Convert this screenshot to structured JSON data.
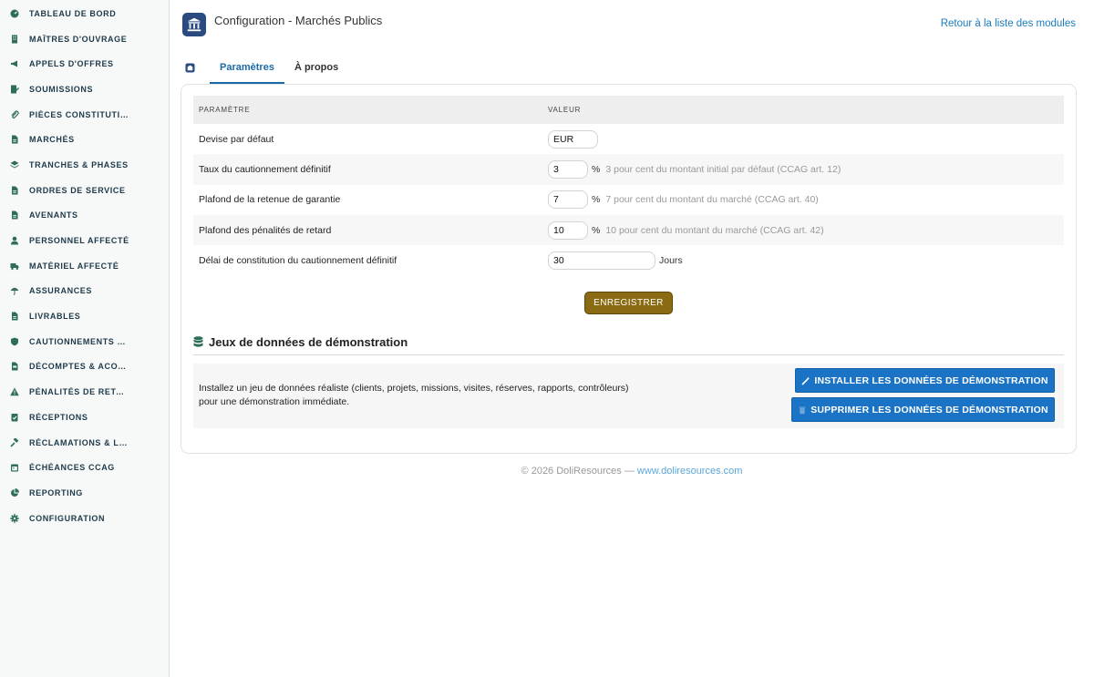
{
  "sidebar": {
    "items": [
      {
        "label": "TABLEAU DE BORD",
        "icon": "dashboard-icon"
      },
      {
        "label": "MAÎTRES D'OUVRAGE",
        "icon": "building-icon"
      },
      {
        "label": "APPELS D'OFFRES",
        "icon": "megaphone-icon"
      },
      {
        "label": "SOUMISSIONS",
        "icon": "file-signature-icon"
      },
      {
        "label": "PIÈCES CONSTITUTIV...",
        "icon": "paperclip-icon"
      },
      {
        "label": "MARCHÉS",
        "icon": "file-icon"
      },
      {
        "label": "TRANCHES & PHASES",
        "icon": "layers-icon"
      },
      {
        "label": "ORDRES DE SERVICE",
        "icon": "file-icon"
      },
      {
        "label": "AVENANTS",
        "icon": "file-icon"
      },
      {
        "label": "PERSONNEL AFFECTÉ",
        "icon": "user-icon"
      },
      {
        "label": "MATÉRIEL AFFECTÉ",
        "icon": "truck-icon"
      },
      {
        "label": "ASSURANCES",
        "icon": "umbrella-icon"
      },
      {
        "label": "LIVRABLES",
        "icon": "file-icon"
      },
      {
        "label": "CAUTIONNEMENTS & ...",
        "icon": "shield-icon"
      },
      {
        "label": "DÉCOMPTES & ACOM...",
        "icon": "file-invoice-icon"
      },
      {
        "label": "PÉNALITÉS DE RETARD",
        "icon": "warning-icon"
      },
      {
        "label": "RÉCEPTIONS",
        "icon": "clipboard-check-icon"
      },
      {
        "label": "RÉCLAMATIONS & LIT...",
        "icon": "gavel-icon"
      },
      {
        "label": "ÉCHÉANCES CCAG",
        "icon": "calendar-icon"
      },
      {
        "label": "REPORTING",
        "icon": "pie-chart-icon"
      },
      {
        "label": "CONFIGURATION",
        "icon": "gear-icon"
      }
    ]
  },
  "header": {
    "title": "Configuration - Marchés Publics",
    "back_link": "Retour à la liste des modules"
  },
  "tabs": [
    {
      "label": "Paramètres",
      "active": true
    },
    {
      "label": "À propos",
      "active": false
    }
  ],
  "table": {
    "col_param": "Paramètre",
    "col_value": "Valeur",
    "rows": [
      {
        "label": "Devise par défaut",
        "value": "EUR",
        "unit": "",
        "hint": ""
      },
      {
        "label": "Taux du cautionnement définitif",
        "value": "3",
        "unit": "%",
        "hint": "3 pour cent du montant initial par défaut (CCAG art. 12)"
      },
      {
        "label": "Plafond de la retenue de garantie",
        "value": "7",
        "unit": "%",
        "hint": "7 pour cent du montant du marché (CCAG art. 40)"
      },
      {
        "label": "Plafond des pénalités de retard",
        "value": "10",
        "unit": "%",
        "hint": "10 pour cent du montant du marché (CCAG art. 42)"
      },
      {
        "label": "Délai de constitution du cautionnement définitif",
        "value": "30",
        "unit": "Jours",
        "hint": ""
      }
    ]
  },
  "save_button": "ENREGISTRER",
  "demo": {
    "title": "Jeux de données de démonstration",
    "text_line1": "Installez un jeu de données réaliste (clients, projets, missions, visites, réserves, rapports, contrôleurs)",
    "text_line2": "pour une démonstration immédiate.",
    "install_button": "INSTALLER LES DONNÉES DE DÉMONSTRATION",
    "delete_button": "SUPPRIMER LES DONNÉES DE DÉMONSTRATION"
  },
  "footer": {
    "copyright": "© 2026 DoliResources —",
    "link": "www.doliresources.com"
  },
  "colors": {
    "accent": "#1a6aa8",
    "save_button": "#8a6a12",
    "demo_buttons": "#1a73c4",
    "sidebar_icon": "#2c6e5a"
  }
}
